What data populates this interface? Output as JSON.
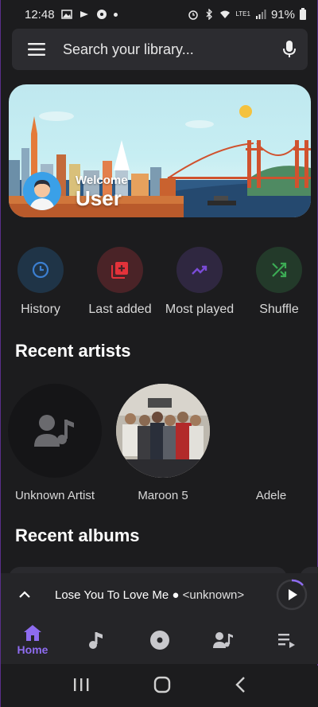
{
  "status_bar": {
    "time": "12:48",
    "battery": "91%",
    "network": "LTE1"
  },
  "search": {
    "placeholder": "Search your library..."
  },
  "banner": {
    "greeting": "Welcome",
    "user_name": "User"
  },
  "quick_actions": [
    {
      "label": "History",
      "icon": "clock-icon",
      "color": "#3b7fd1",
      "bg": "#1f3447"
    },
    {
      "label": "Last added",
      "icon": "library-add-icon",
      "color": "#e3323a",
      "bg": "#4a2327"
    },
    {
      "label": "Most played",
      "icon": "trending-up-icon",
      "color": "#7a4bd6",
      "bg": "#2f2740"
    },
    {
      "label": "Shuffle",
      "icon": "shuffle-icon",
      "color": "#3cab54",
      "bg": "#233a2a"
    }
  ],
  "sections": {
    "recent_artists": "Recent artists",
    "recent_albums": "Recent albums"
  },
  "artists": [
    {
      "name": "Unknown Artist"
    },
    {
      "name": "Maroon 5"
    },
    {
      "name": "Adele"
    }
  ],
  "mini_player": {
    "title": "Lose You To Love Me",
    "separator": "●",
    "artist": "<unknown>"
  },
  "bottom_nav": {
    "home_label": "Home",
    "active_color": "#8e6cf0"
  }
}
